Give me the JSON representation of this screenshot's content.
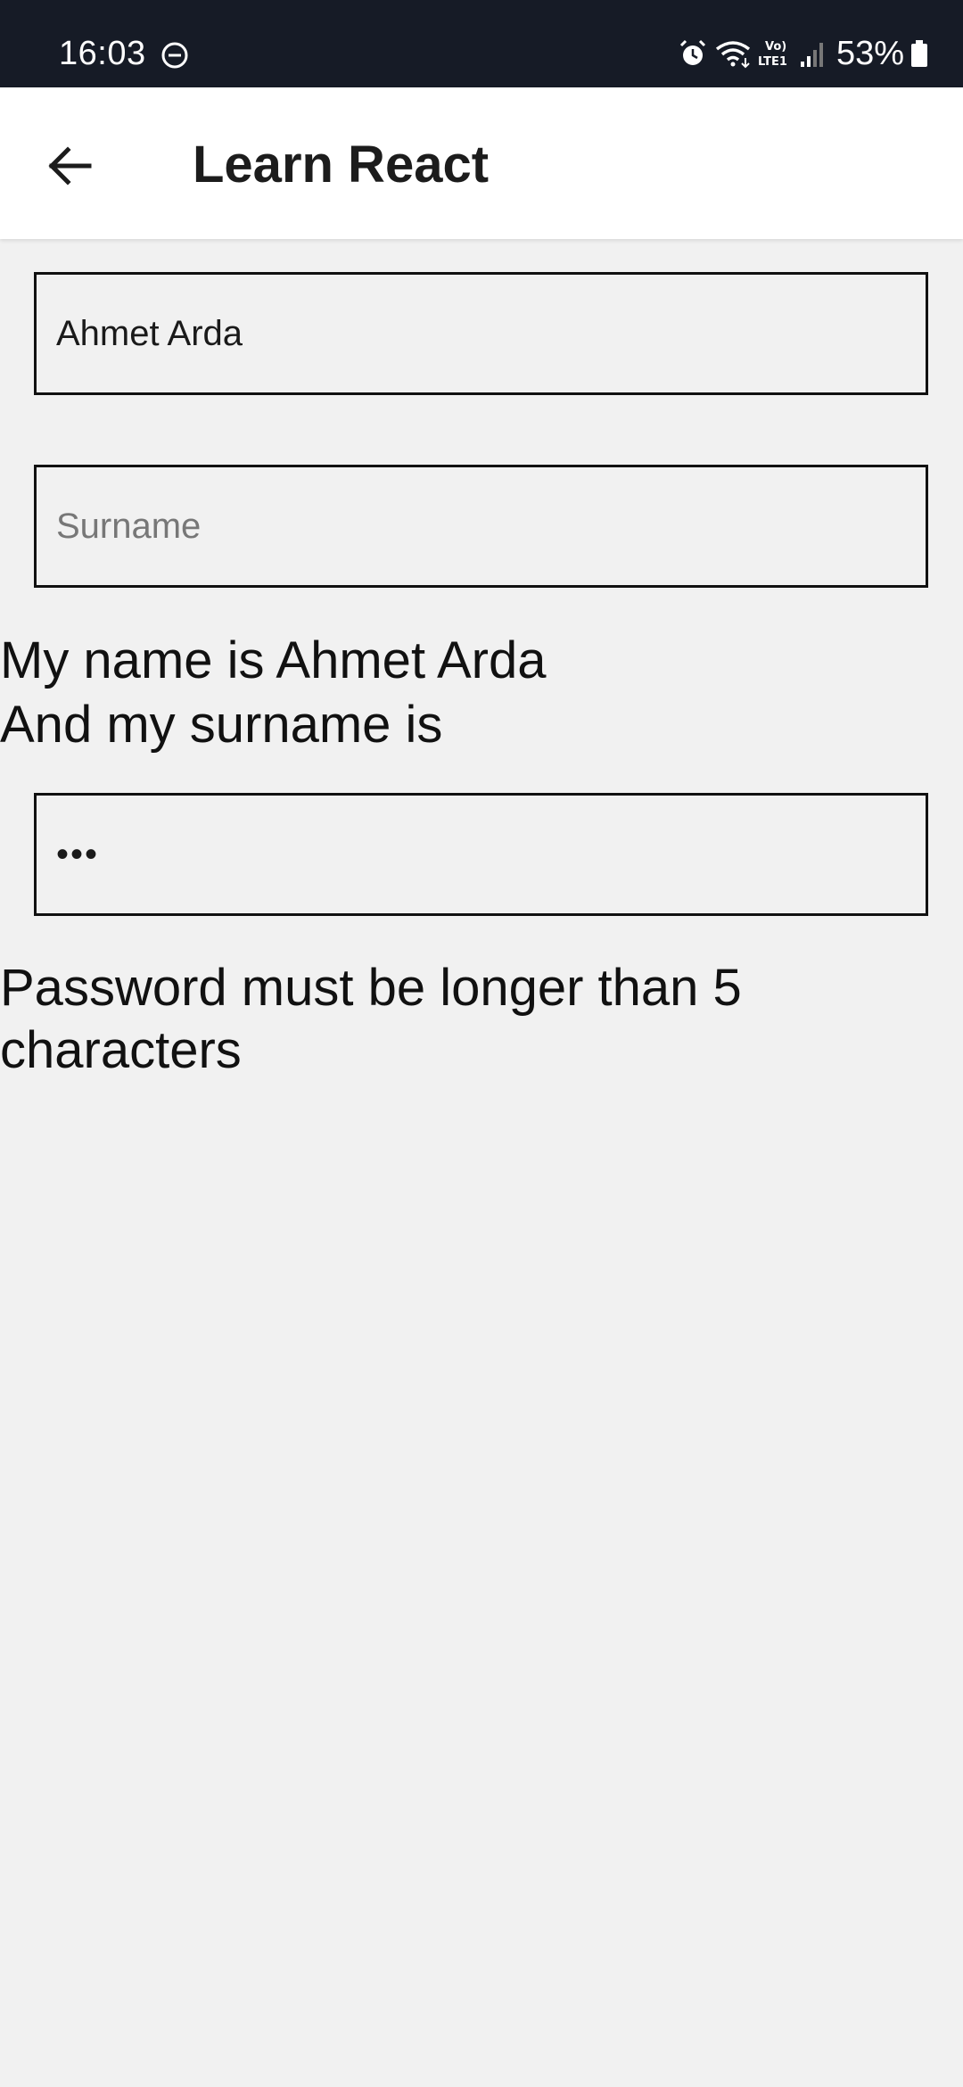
{
  "status_bar": {
    "time": "16:03",
    "dnd_icon": "do-not-disturb-icon",
    "alarm_icon": "alarm-icon",
    "wifi_icon": "wifi-icon",
    "volte_label": "VoLTE1",
    "signal_icon": "signal-icon",
    "battery_percent": "53%",
    "battery_icon": "battery-icon"
  },
  "app_bar": {
    "back_icon": "arrow-left-icon",
    "title": "Learn React"
  },
  "form": {
    "name_value": "Ahmet Arda",
    "name_placeholder": "",
    "surname_value": "",
    "surname_placeholder": "Surname",
    "password_value": "•••"
  },
  "summary": {
    "name_line": "My name is Ahmet Arda",
    "surname_line": "And my surname is"
  },
  "password_warning": "Password must be longer than 5 characters",
  "colors": {
    "status_bar_bg": "#161b26",
    "page_bg": "#f1f1f1",
    "app_bar_bg": "#ffffff"
  }
}
